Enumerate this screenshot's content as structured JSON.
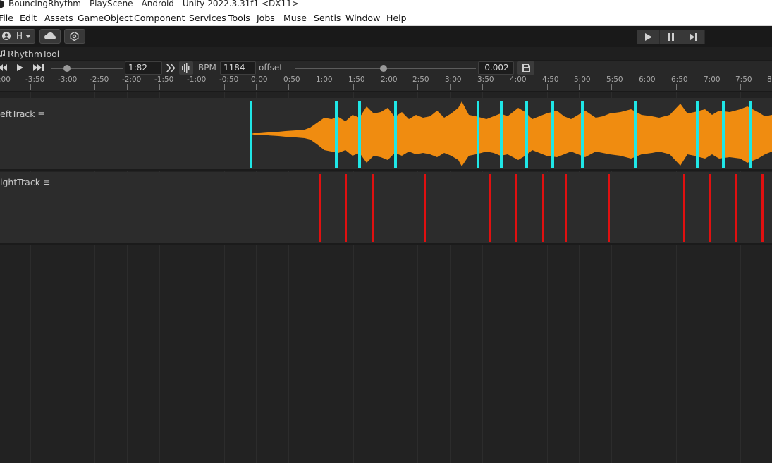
{
  "window": {
    "title": "BouncingRhythm - PlayScene - Android - Unity 2022.3.31f1 <DX11>"
  },
  "menu": [
    "File",
    "Edit",
    "Assets",
    "GameObject",
    "Component",
    "Services",
    "Tools",
    "Jobs",
    "Muse",
    "Sentis",
    "Window",
    "Help"
  ],
  "toolbar": {
    "account_label": "H",
    "account_dropdown_icon": "chevron-down-icon",
    "cloud_icon": "cloud-icon",
    "settings_icon": "gear-icon",
    "play_icon": "play-icon",
    "pause_icon": "pause-icon",
    "step_icon": "step-icon"
  },
  "tab": {
    "title": "RhythmTool",
    "icon": "music-note-icon"
  },
  "transport": {
    "time_value": "1:82",
    "time_slider_fraction": 0.23,
    "bpm_label": "BPM",
    "bpm_value": "1184",
    "offset_label": "offset",
    "offset_value": "-0.002",
    "offset_slider_fraction": 0.49
  },
  "ruler": {
    "labels": [
      ":00",
      "-3:50",
      "-3:00",
      "-2:50",
      "-2:00",
      "-1:50",
      "-1:00",
      "-0:50",
      "0:00",
      "0:50",
      "1:00",
      "1:50",
      "2:00",
      "2:50",
      "3:00",
      "3:50",
      "4:00",
      "4:50",
      "5:00",
      "5:50",
      "6:00",
      "6:50",
      "7:00",
      "7:50",
      "8"
    ]
  },
  "tracks": [
    {
      "name": "eftTrack",
      "menu_icon": "hamburger-icon"
    },
    {
      "name": "ightTrack",
      "menu_icon": "hamburger-icon"
    }
  ],
  "colors": {
    "waveform": "#f08c10",
    "left_marker": "#1fe6e6",
    "right_marker": "#e01010"
  }
}
